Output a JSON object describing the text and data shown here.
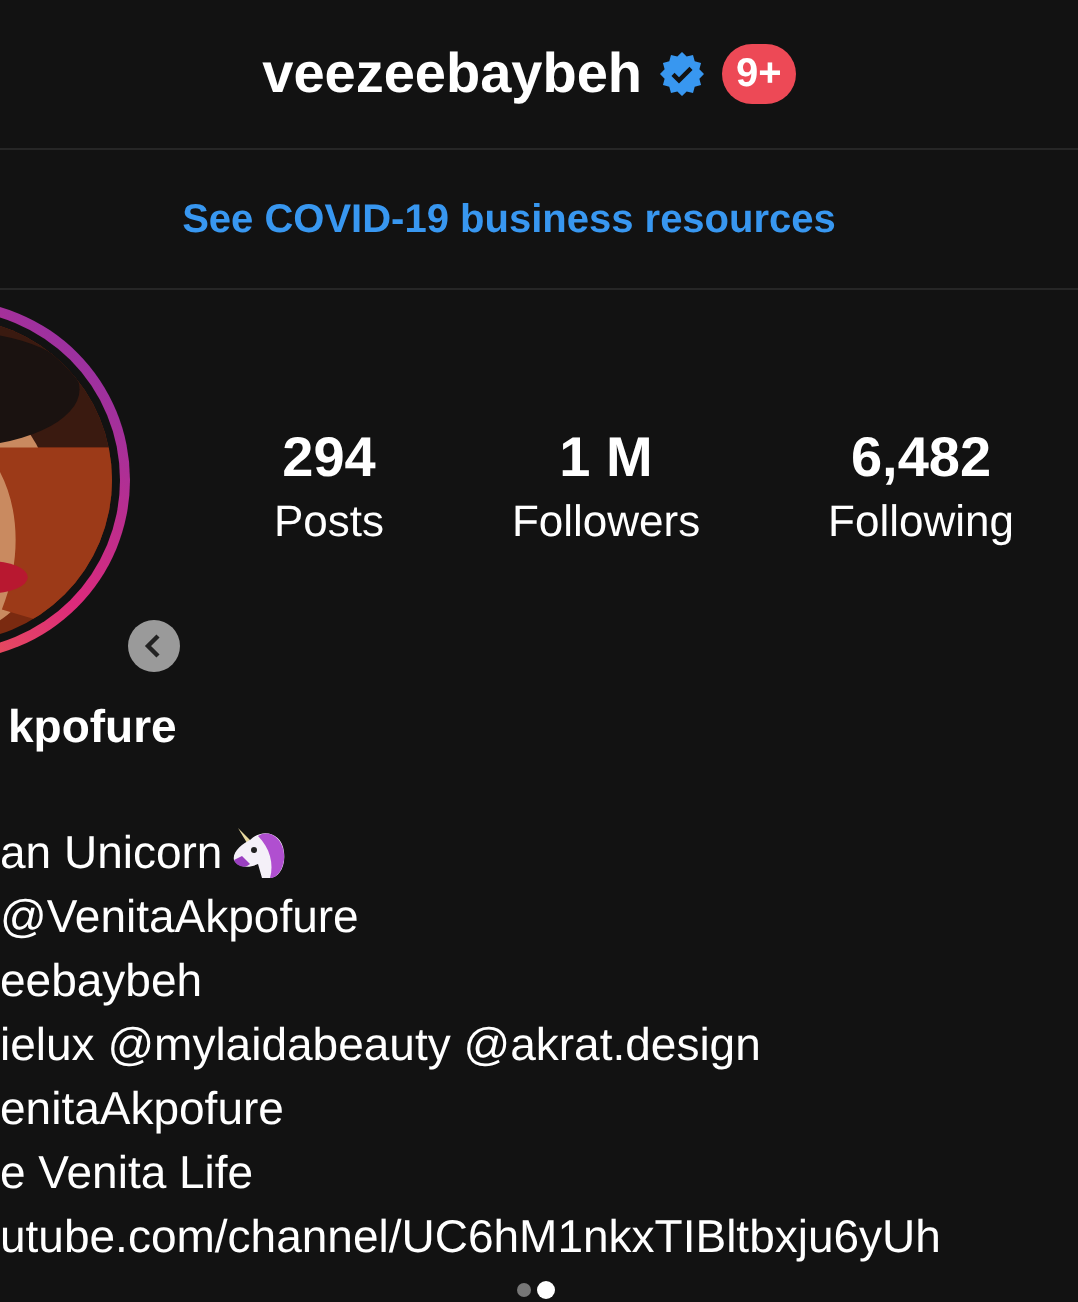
{
  "header": {
    "username": "veezeebaybeh",
    "verified": true,
    "notification_badge": "9+"
  },
  "banner": {
    "link": "See COVID-19 business resources"
  },
  "profile": {
    "avatar": {
      "kind": "picture",
      "story_ring": true
    },
    "name": "kpofure"
  },
  "stats": [
    {
      "value": "294",
      "label": "Posts"
    },
    {
      "value": "1 M",
      "label": "Followers"
    },
    {
      "value": "6,482",
      "label": "Following"
    }
  ],
  "bio": [
    {
      "kind": "with_emoji",
      "text": "an Unicorn"
    },
    {
      "kind": "text",
      "text": "@VenitaAkpofure"
    },
    {
      "kind": "text",
      "text": "eebaybeh"
    },
    {
      "kind": "text",
      "text": "ielux @mylaidabeauty @akrat.design"
    },
    {
      "kind": "text",
      "text": "enitaAkpofure"
    },
    {
      "kind": "text",
      "text": "e Venita Life"
    },
    {
      "kind": "text",
      "text": "utube.com/channel/UC6hM1nkxTIBltbxju6yUh"
    }
  ]
}
